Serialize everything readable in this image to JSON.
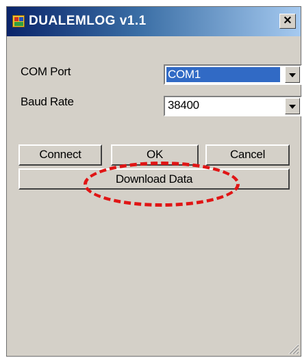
{
  "window": {
    "title": "DUALEMLOG v1.1",
    "close_glyph": "✕"
  },
  "fields": {
    "com_port": {
      "label": "COM Port",
      "value": "COM1"
    },
    "baud_rate": {
      "label": "Baud Rate",
      "value": "38400"
    }
  },
  "buttons": {
    "connect": "Connect",
    "ok": "OK",
    "cancel": "Cancel",
    "download": "Download Data"
  },
  "annotation": {
    "color": "#e01515"
  },
  "icons": [
    "app-icon",
    "close-icon",
    "chevron-down-icon",
    "resize-grip-icon"
  ],
  "colors": {
    "face": "#d4d0c8",
    "titlebar": "#0a246a",
    "selection": "#316ac5"
  }
}
